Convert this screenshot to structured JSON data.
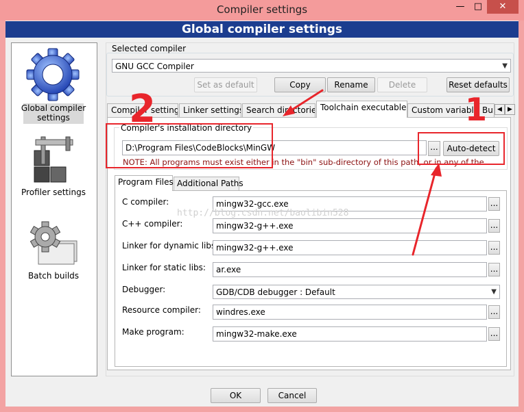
{
  "window": {
    "title": "Compiler settings",
    "minimize": "—",
    "maximize": "□",
    "close": "✕"
  },
  "header": {
    "title": "Global compiler settings"
  },
  "sidebar": {
    "items": [
      {
        "label": "Global compiler settings",
        "icon": "gear-icon",
        "selected": true
      },
      {
        "label": "Profiler settings",
        "icon": "profiler-icon"
      },
      {
        "label": "Batch builds",
        "icon": "batch-builds-icon"
      }
    ]
  },
  "compiler": {
    "section_label": "Selected compiler",
    "selected": "GNU GCC Compiler",
    "buttons": {
      "set_default": "Set as default",
      "copy": "Copy",
      "rename": "Rename",
      "delete": "Delete",
      "reset": "Reset defaults"
    }
  },
  "tabs": [
    {
      "label": "Compiler settings"
    },
    {
      "label": "Linker settings"
    },
    {
      "label": "Search directories"
    },
    {
      "label": "Toolchain executables",
      "active": true
    },
    {
      "label": "Custom variables"
    },
    {
      "label": "Build options"
    }
  ],
  "toolchain": {
    "install_dir_label": "Compiler's installation directory",
    "install_dir": "D:\\Program Files\\CodeBlocks\\MinGW",
    "browse": "...",
    "autodetect": "Auto-detect",
    "note": "NOTE: All programs must exist either in the \"bin\" sub-directory of this path, or in any of the \"Additional paths\"",
    "inner_tabs": [
      {
        "label": "Program Files",
        "active": true
      },
      {
        "label": "Additional Paths"
      }
    ],
    "fields": [
      {
        "label": "C compiler:",
        "value": "mingw32-gcc.exe"
      },
      {
        "label": "C++ compiler:",
        "value": "mingw32-g++.exe"
      },
      {
        "label": "Linker for dynamic libs:",
        "value": "mingw32-g++.exe"
      },
      {
        "label": "Linker for static libs:",
        "value": "ar.exe"
      },
      {
        "label": "Debugger:",
        "value": "GDB/CDB debugger : Default"
      },
      {
        "label": "Resource compiler:",
        "value": "windres.exe"
      },
      {
        "label": "Make program:",
        "value": "mingw32-make.exe"
      }
    ]
  },
  "footer": {
    "ok": "OK",
    "cancel": "Cancel"
  },
  "watermark": "http://blog.csdn.net/baolibin528",
  "annotations": {
    "mark_1": "1",
    "mark_2": "2",
    "color": "#e8252b"
  }
}
